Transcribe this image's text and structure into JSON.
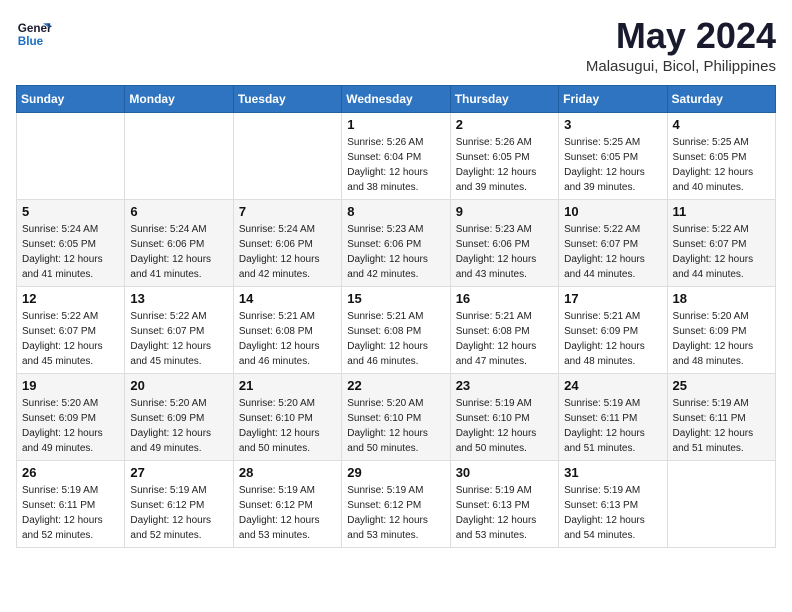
{
  "logo": {
    "line1": "General",
    "line2": "Blue"
  },
  "title": "May 2024",
  "subtitle": "Malasugui, Bicol, Philippines",
  "weekdays": [
    "Sunday",
    "Monday",
    "Tuesday",
    "Wednesday",
    "Thursday",
    "Friday",
    "Saturday"
  ],
  "weeks": [
    [
      {
        "day": "",
        "info": ""
      },
      {
        "day": "",
        "info": ""
      },
      {
        "day": "",
        "info": ""
      },
      {
        "day": "1",
        "info": "Sunrise: 5:26 AM\nSunset: 6:04 PM\nDaylight: 12 hours\nand 38 minutes."
      },
      {
        "day": "2",
        "info": "Sunrise: 5:26 AM\nSunset: 6:05 PM\nDaylight: 12 hours\nand 39 minutes."
      },
      {
        "day": "3",
        "info": "Sunrise: 5:25 AM\nSunset: 6:05 PM\nDaylight: 12 hours\nand 39 minutes."
      },
      {
        "day": "4",
        "info": "Sunrise: 5:25 AM\nSunset: 6:05 PM\nDaylight: 12 hours\nand 40 minutes."
      }
    ],
    [
      {
        "day": "5",
        "info": "Sunrise: 5:24 AM\nSunset: 6:05 PM\nDaylight: 12 hours\nand 41 minutes."
      },
      {
        "day": "6",
        "info": "Sunrise: 5:24 AM\nSunset: 6:06 PM\nDaylight: 12 hours\nand 41 minutes."
      },
      {
        "day": "7",
        "info": "Sunrise: 5:24 AM\nSunset: 6:06 PM\nDaylight: 12 hours\nand 42 minutes."
      },
      {
        "day": "8",
        "info": "Sunrise: 5:23 AM\nSunset: 6:06 PM\nDaylight: 12 hours\nand 42 minutes."
      },
      {
        "day": "9",
        "info": "Sunrise: 5:23 AM\nSunset: 6:06 PM\nDaylight: 12 hours\nand 43 minutes."
      },
      {
        "day": "10",
        "info": "Sunrise: 5:22 AM\nSunset: 6:07 PM\nDaylight: 12 hours\nand 44 minutes."
      },
      {
        "day": "11",
        "info": "Sunrise: 5:22 AM\nSunset: 6:07 PM\nDaylight: 12 hours\nand 44 minutes."
      }
    ],
    [
      {
        "day": "12",
        "info": "Sunrise: 5:22 AM\nSunset: 6:07 PM\nDaylight: 12 hours\nand 45 minutes."
      },
      {
        "day": "13",
        "info": "Sunrise: 5:22 AM\nSunset: 6:07 PM\nDaylight: 12 hours\nand 45 minutes."
      },
      {
        "day": "14",
        "info": "Sunrise: 5:21 AM\nSunset: 6:08 PM\nDaylight: 12 hours\nand 46 minutes."
      },
      {
        "day": "15",
        "info": "Sunrise: 5:21 AM\nSunset: 6:08 PM\nDaylight: 12 hours\nand 46 minutes."
      },
      {
        "day": "16",
        "info": "Sunrise: 5:21 AM\nSunset: 6:08 PM\nDaylight: 12 hours\nand 47 minutes."
      },
      {
        "day": "17",
        "info": "Sunrise: 5:21 AM\nSunset: 6:09 PM\nDaylight: 12 hours\nand 48 minutes."
      },
      {
        "day": "18",
        "info": "Sunrise: 5:20 AM\nSunset: 6:09 PM\nDaylight: 12 hours\nand 48 minutes."
      }
    ],
    [
      {
        "day": "19",
        "info": "Sunrise: 5:20 AM\nSunset: 6:09 PM\nDaylight: 12 hours\nand 49 minutes."
      },
      {
        "day": "20",
        "info": "Sunrise: 5:20 AM\nSunset: 6:09 PM\nDaylight: 12 hours\nand 49 minutes."
      },
      {
        "day": "21",
        "info": "Sunrise: 5:20 AM\nSunset: 6:10 PM\nDaylight: 12 hours\nand 50 minutes."
      },
      {
        "day": "22",
        "info": "Sunrise: 5:20 AM\nSunset: 6:10 PM\nDaylight: 12 hours\nand 50 minutes."
      },
      {
        "day": "23",
        "info": "Sunrise: 5:19 AM\nSunset: 6:10 PM\nDaylight: 12 hours\nand 50 minutes."
      },
      {
        "day": "24",
        "info": "Sunrise: 5:19 AM\nSunset: 6:11 PM\nDaylight: 12 hours\nand 51 minutes."
      },
      {
        "day": "25",
        "info": "Sunrise: 5:19 AM\nSunset: 6:11 PM\nDaylight: 12 hours\nand 51 minutes."
      }
    ],
    [
      {
        "day": "26",
        "info": "Sunrise: 5:19 AM\nSunset: 6:11 PM\nDaylight: 12 hours\nand 52 minutes."
      },
      {
        "day": "27",
        "info": "Sunrise: 5:19 AM\nSunset: 6:12 PM\nDaylight: 12 hours\nand 52 minutes."
      },
      {
        "day": "28",
        "info": "Sunrise: 5:19 AM\nSunset: 6:12 PM\nDaylight: 12 hours\nand 53 minutes."
      },
      {
        "day": "29",
        "info": "Sunrise: 5:19 AM\nSunset: 6:12 PM\nDaylight: 12 hours\nand 53 minutes."
      },
      {
        "day": "30",
        "info": "Sunrise: 5:19 AM\nSunset: 6:13 PM\nDaylight: 12 hours\nand 53 minutes."
      },
      {
        "day": "31",
        "info": "Sunrise: 5:19 AM\nSunset: 6:13 PM\nDaylight: 12 hours\nand 54 minutes."
      },
      {
        "day": "",
        "info": ""
      }
    ]
  ]
}
